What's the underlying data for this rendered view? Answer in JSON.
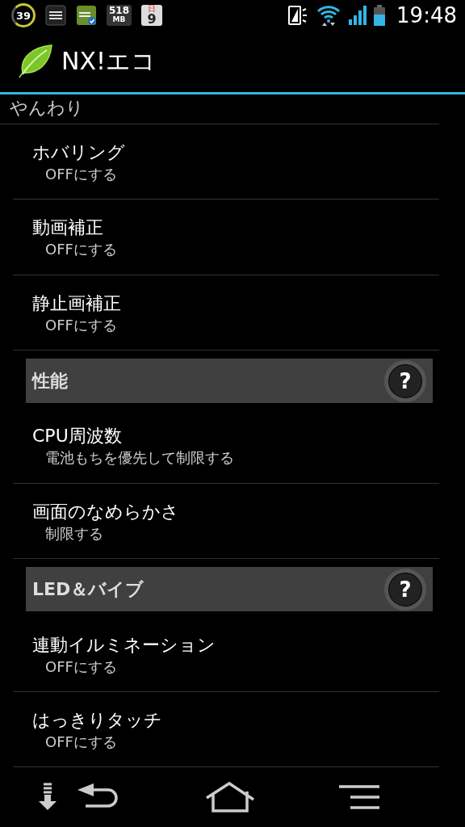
{
  "status_bar": {
    "battery_saver": "39",
    "memory": "518",
    "memory_unit": "MB",
    "calendar_day": "日",
    "calendar_date": "9",
    "time": "19:48"
  },
  "app_bar": {
    "title": "NX!エコ"
  },
  "items": [
    {
      "kind": "category",
      "title": "やんわり"
    },
    {
      "kind": "setting",
      "title": "ホバリング",
      "summary": "OFFにする"
    },
    {
      "kind": "setting",
      "title": "動画補正",
      "summary": "OFFにする"
    },
    {
      "kind": "setting",
      "title": "静止画補正",
      "summary": "OFFにする"
    },
    {
      "kind": "section",
      "title": "性能",
      "help": "?"
    },
    {
      "kind": "setting",
      "title": "CPU周波数",
      "summary": "電池もちを優先して制限する"
    },
    {
      "kind": "setting",
      "title": "画面のなめらかさ",
      "summary": "制限する"
    },
    {
      "kind": "section",
      "title": "LED＆バイブ",
      "help": "?"
    },
    {
      "kind": "setting",
      "title": "連動イルミネーション",
      "summary": "OFFにする"
    },
    {
      "kind": "setting",
      "title": "はっきりタッチ",
      "summary": "OFFにする"
    }
  ]
}
